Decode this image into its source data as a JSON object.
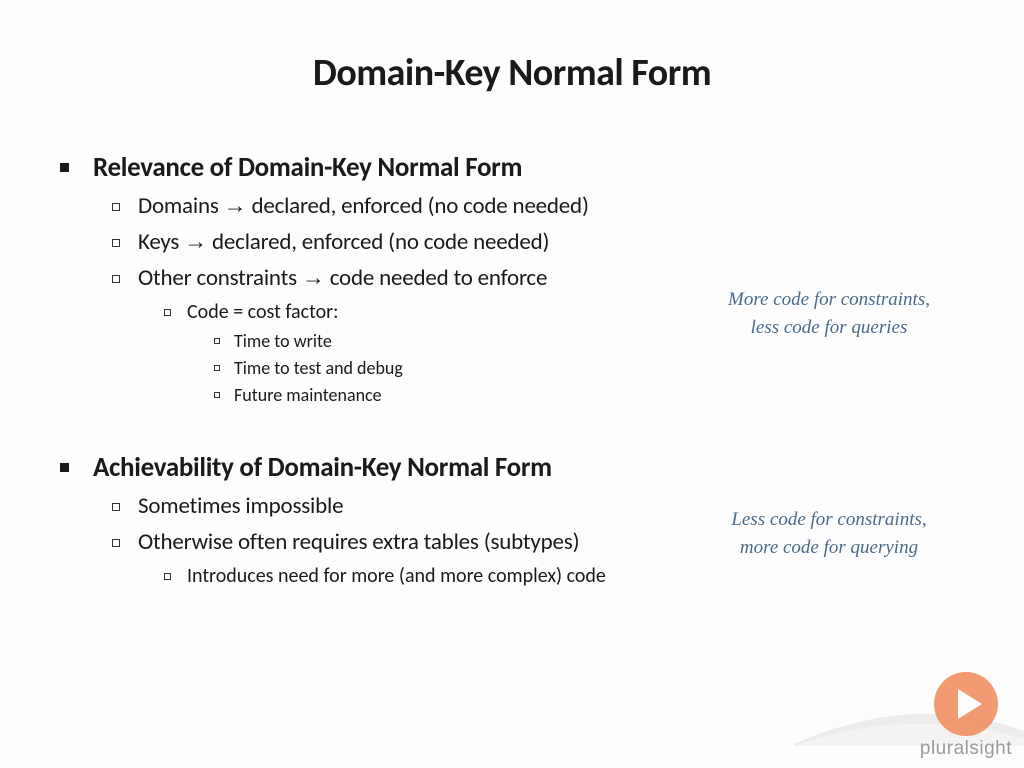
{
  "title": "Domain-Key Normal Form",
  "section1": {
    "heading": "Relevance of Domain-Key Normal Form",
    "b1_pre": "Domains ",
    "b1_post": " declared, enforced (no code needed)",
    "b2_pre": "Keys ",
    "b2_post": " declared, enforced (no code needed)",
    "b3_pre": "Other constraints ",
    "b3_post": " code needed to enforce",
    "c1": "Code = cost factor:",
    "d1": "Time to write",
    "d2": "Time to test and debug",
    "d3": "Future maintenance"
  },
  "annotation1_line1": "More code for constraints,",
  "annotation1_line2": "less code for queries",
  "section2": {
    "heading": "Achievability of Domain-Key Normal Form",
    "b1": "Sometimes impossible",
    "b2": "Otherwise often requires extra tables (subtypes)",
    "c1": "Introduces need for more (and more complex) code"
  },
  "annotation2_line1": "Less code for constraints,",
  "annotation2_line2": "more code for querying",
  "arrow_glyph": "→",
  "brand": "pluralsight"
}
